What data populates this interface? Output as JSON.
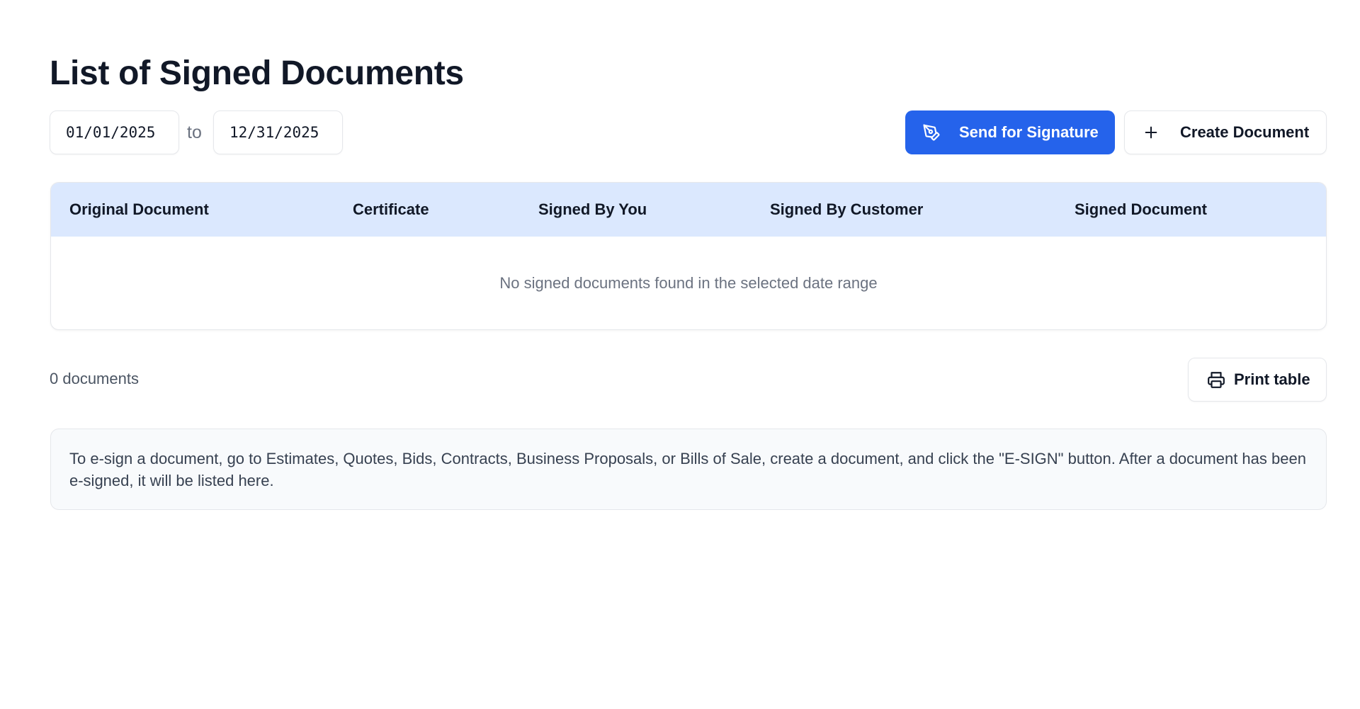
{
  "page": {
    "title": "List of Signed Documents"
  },
  "filters": {
    "date_from": "01/01/2025",
    "to_label": "to",
    "date_to": "12/31/2025"
  },
  "actions": {
    "send_for_signature_label": "Send for Signature",
    "send_for_signature_icon": "pen-nib-icon",
    "create_document_label": "Create Document",
    "create_document_icon": "plus-icon"
  },
  "table": {
    "columns": [
      "Original Document",
      "Certificate",
      "Signed By You",
      "Signed By Customer",
      "Signed Document"
    ],
    "rows": [],
    "empty_message": "No signed documents found in the selected date range"
  },
  "footer": {
    "document_count": "0 documents",
    "print_label": "Print table",
    "print_icon": "printer-icon"
  },
  "info": {
    "text": "To e-sign a document, go to Estimates, Quotes, Bids, Contracts, Business Proposals, or Bills of Sale, create a document, and click the \"E-SIGN\" button. After a document has been e-signed, it will be listed here."
  },
  "colors": {
    "primary": "#2563eb",
    "table_header_bg": "#dbe8fe",
    "info_bg": "#f8fafc",
    "border": "#e5e7eb"
  }
}
